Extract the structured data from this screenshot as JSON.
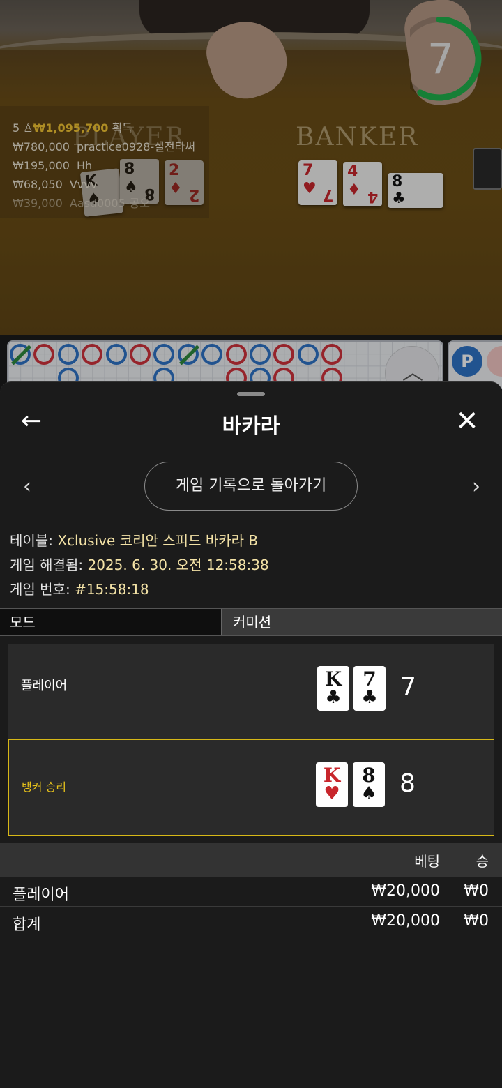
{
  "video": {
    "timer_seconds": "7",
    "timer_progress": 0.58,
    "player_label": "PLAYER",
    "banker_label": "BANKER",
    "winners_summary": {
      "count": "5",
      "total": "₩1,095,700",
      "suffix": "획득"
    },
    "winners": [
      {
        "amount": "₩780,000",
        "name": "practice0928-실전타써"
      },
      {
        "amount": "₩195,000",
        "name": "Hh"
      },
      {
        "amount": "₩68,050",
        "name": "Vvvv"
      },
      {
        "amount": "₩39,000",
        "name": "Aasd0005-공오"
      }
    ]
  },
  "roadmap": {
    "beads_top": [
      "P-tie",
      "B",
      "P",
      "B",
      "P",
      "B",
      "P",
      "P-tie",
      "P",
      "B",
      "P",
      "B",
      "P",
      "B"
    ],
    "scroll_icon": "double-chevron-up-icon",
    "p_badge": "P"
  },
  "sheet": {
    "title": "바카라",
    "back_icon": "arrow-left-icon",
    "close_icon": "close-icon",
    "history_button": "게임 기록으로 돌아가기",
    "info": {
      "table_label": "테이블:",
      "table_value": "Xclusive 코리안 스피드 바카라 B",
      "resolved_label": "게임 해결됨:",
      "resolved_value": "2025. 6. 30. 오전 12:58:38",
      "number_label": "게임 번호:",
      "number_value": "#15:58:18"
    },
    "mode": {
      "label": "모드",
      "value": "커미션"
    },
    "player_hand": {
      "label": "플레이어",
      "cards": [
        {
          "value": "K",
          "suit": "♣",
          "color": "black"
        },
        {
          "value": "7",
          "suit": "♣",
          "color": "black"
        }
      ],
      "total": "7"
    },
    "banker_hand": {
      "label": "뱅커 승리",
      "cards": [
        {
          "value": "K",
          "suit": "♥",
          "color": "red"
        },
        {
          "value": "8",
          "suit": "♠",
          "color": "black"
        }
      ],
      "total": "8"
    },
    "bets": {
      "headers": {
        "bet": "베팅",
        "win": "승"
      },
      "rows": [
        {
          "label": "플레이어",
          "bet": "₩20,000",
          "win": "₩0"
        },
        {
          "label": "합계",
          "bet": "₩20,000",
          "win": "₩0"
        }
      ]
    }
  },
  "colors": {
    "accent_gold": "#e8c31b",
    "banker_red": "#d0323c",
    "player_blue": "#2f73c7",
    "timer_green": "#1fb04b"
  }
}
